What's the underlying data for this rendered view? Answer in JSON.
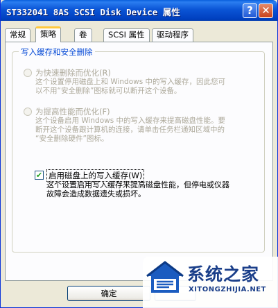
{
  "window": {
    "title": "ST332041 8AS SCSI Disk Device 属性",
    "help_label": "?",
    "close_label": "✕"
  },
  "tabs": [
    {
      "label": "常规",
      "active": false
    },
    {
      "label": "策略",
      "active": true
    },
    {
      "label": "卷",
      "active": false
    },
    {
      "label": "SCSI 属性",
      "active": false
    },
    {
      "label": "驱动程序",
      "active": false
    }
  ],
  "group": {
    "legend": "写入缓存和安全删除",
    "option1": {
      "label": "为快速删除而优化(R)",
      "desc": [
        "这个设置停用磁盘上和 Windows 中的写入缓存，因此您可",
        "以不用“安全删除”图标就可以断开这个设备。"
      ]
    },
    "option2": {
      "label": "为提高性能而优化(F)",
      "desc": [
        "这个设备启用 Windows 中的写入缓存来提高磁盘性能。要",
        "断开这个设备跟计算机的连接，请单击任务栏通知区域中的",
        "“安全删除硬件”图标。"
      ]
    },
    "checkbox": {
      "label": "启用磁盘上的写入缓存(W)",
      "checked": true,
      "desc": [
        "这个设置启用写入缓存来提高磁盘性能，但停电或仪器",
        "故障会造成数据遗失或损坏。"
      ]
    }
  },
  "footer": {
    "ok_label": "确定"
  },
  "watermark": {
    "name": "系统之家",
    "url": "XITONGZHIJIA.NET"
  },
  "colors": {
    "titlebar": "#0b55d6",
    "legend": "#0046d5",
    "disabled_text": "#aca899",
    "check_mark": "#21a121"
  }
}
